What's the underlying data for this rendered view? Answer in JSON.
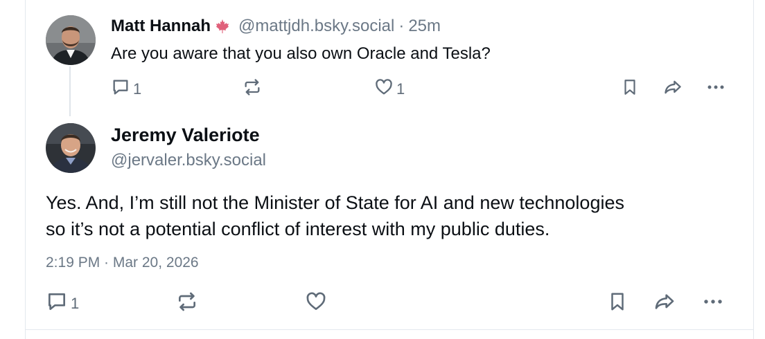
{
  "reply": {
    "author_name": "Matt Hannah",
    "author_flag_icon": "maple-leaf-icon",
    "author_handle": "@mattjdh.bsky.social",
    "separator": "·",
    "time": "25m",
    "text": "Are you aware that you also own Oracle and Tesla?",
    "actions": {
      "reply_icon": "comment-icon",
      "reply_count": "1",
      "repost_icon": "repost-icon",
      "like_icon": "heart-icon",
      "like_count": "1",
      "bookmark_icon": "bookmark-icon",
      "share_icon": "share-icon",
      "more_icon": "more-icon"
    }
  },
  "post": {
    "author_name": "Jeremy Valeriote",
    "author_handle": "@jervaler.bsky.social",
    "text_lines": [
      "Yes. And, I’m still not the Minister of State for AI and new technologies",
      "so it’s not a potential conflict of interest with my public duties."
    ],
    "timestamp": "2:19 PM · Mar 20, 2026",
    "actions": {
      "reply_icon": "comment-icon",
      "reply_count": "1",
      "repost_icon": "repost-icon",
      "like_icon": "heart-icon",
      "bookmark_icon": "bookmark-icon",
      "share_icon": "share-icon",
      "more_icon": "more-icon"
    }
  },
  "colors": {
    "text": "#0b0f14",
    "muted": "#6b7886",
    "icon": "#5f6b78",
    "maple": "#e0607a",
    "divider": "#e3e8ee"
  }
}
